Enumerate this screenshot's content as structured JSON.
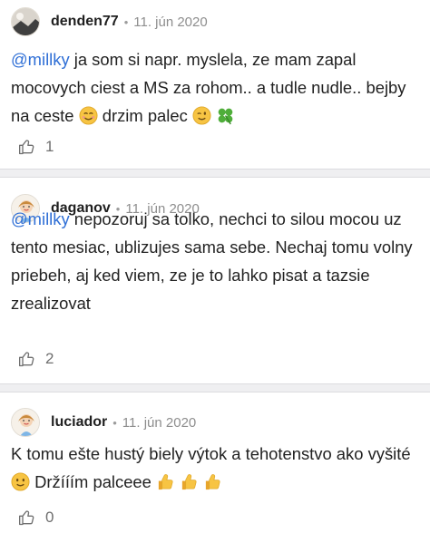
{
  "comments": [
    {
      "username": "denden77",
      "separator": "•",
      "date": "11. jún 2020",
      "mention": "@millky",
      "text_l1": " ja som si napr. myslela, ze mam zapal",
      "text_l2": "mocovych ciest a MS za rohom.. a tudle nudle.. bejby",
      "text_l3a": "na ceste ",
      "text_l3b": " drzim palec ",
      "likes": "1"
    },
    {
      "username": "daganov",
      "separator": "•",
      "date": "11. jún 2020",
      "mention": "@millky",
      "text_l1": " nepozoruj sa tolko, nechci to silou mocou uz",
      "text_l2": "tento mesiac, ublizujes sama sebe. Nechaj tomu volny",
      "text_l3": "priebeh, aj ked viem, ze je to lahko pisat a tazsie",
      "text_l4": "zrealizovat",
      "likes": "2"
    },
    {
      "username": "luciador",
      "separator": "•",
      "date": "11. jún 2020",
      "text_l1": "K tomu ešte hustý biely výtok a tehotenstvo ako vyšité",
      "text_l2": " Držííím palceee ",
      "likes": "0"
    }
  ],
  "icons": {
    "like": "thumbs-up-outline-icon",
    "smile": "smiling-face-emoji",
    "wink": "winking-face-emoji",
    "clover": "four-leaf-clover-emoji",
    "slight_smile": "slightly-smiling-face-emoji",
    "thumbs_up": "thumbs-up-emoji"
  },
  "colors": {
    "mention": "#2f6fd6",
    "separator_band": "#efeff1",
    "muted_text": "#8e8e8e"
  }
}
